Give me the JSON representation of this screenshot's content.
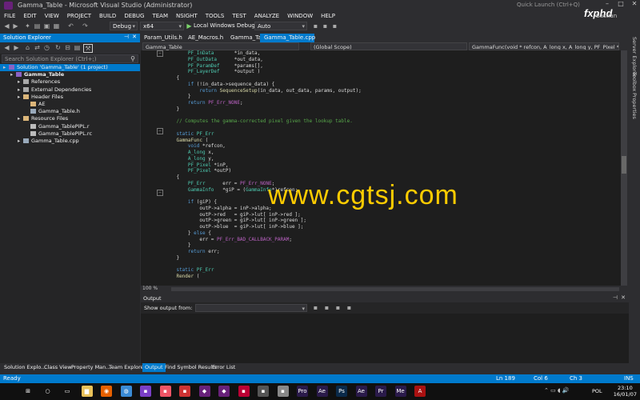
{
  "window": {
    "title": "Gamma_Table - Microsoft Visual Studio (Administrator)",
    "quick_launch": "Quick Launch (Ctrl+Q)",
    "user": "Bastian"
  },
  "watermark": {
    "text": "www.cgtsj.com",
    "logo": "fxphd"
  },
  "menu": [
    "FILE",
    "EDIT",
    "VIEW",
    "PROJECT",
    "BUILD",
    "DEBUG",
    "TEAM",
    "NSIGHT",
    "TOOLS",
    "TEST",
    "ANALYZE",
    "WINDOW",
    "HELP"
  ],
  "toolbar": {
    "config": "Debug",
    "platform": "x64",
    "debugger": "Local Windows Debugger",
    "mode": "Auto"
  },
  "solution_explorer": {
    "title": "Solution Explorer",
    "search_placeholder": "Search Solution Explorer (Ctrl+;)",
    "items": [
      {
        "label": "Solution 'Gamma_Table' (1 project)",
        "indent": 0,
        "selected": true,
        "icon": "solution-icon"
      },
      {
        "label": "Gamma_Table",
        "indent": 1,
        "bold": true,
        "icon": "project-icon"
      },
      {
        "label": "References",
        "indent": 2,
        "icon": "references-icon"
      },
      {
        "label": "External Dependencies",
        "indent": 2,
        "icon": "dependencies-icon"
      },
      {
        "label": "Header Files",
        "indent": 2,
        "icon": "folder-icon"
      },
      {
        "label": "AE",
        "indent": 3,
        "icon": "folder-icon"
      },
      {
        "label": "Gamma_Table.h",
        "indent": 3,
        "icon": "header-file-icon"
      },
      {
        "label": "Resource Files",
        "indent": 2,
        "icon": "folder-icon"
      },
      {
        "label": "Gamma_TablePiPL.r",
        "indent": 3,
        "icon": "resource-file-icon"
      },
      {
        "label": "Gamma_TablePiPL.rc",
        "indent": 3,
        "icon": "resource-file-icon"
      },
      {
        "label": "Gamma_Table.cpp",
        "indent": 2,
        "icon": "cpp-file-icon"
      }
    ]
  },
  "tabs": [
    "Param_Utils.h",
    "AE_Macros.h",
    "Gamma_Table.h",
    "Gamma_Table.cpp"
  ],
  "nav": {
    "project": "Gamma_Table",
    "scope": "(Global Scope)",
    "func": "GammaFunc(void * refcon, A_long x, A_long y, PF_Pixel * inP, PF_Pixel"
  },
  "zoom": "100 %",
  "output": {
    "title": "Output",
    "show_from": "Show output from:"
  },
  "bottom_tabs": [
    "Solution Explo...",
    "Class View",
    "Property Man...",
    "Team Explorer",
    "Output",
    "Find Symbol Results",
    "Error List"
  ],
  "status": {
    "ready": "Ready",
    "ln": "Ln 189",
    "col": "Col 6",
    "ch": "Ch 3",
    "ins": "INS"
  },
  "right_tabs": [
    "Server Explorer",
    "Toolbox",
    "Properties"
  ],
  "clock": {
    "time": "23:10",
    "date": "16/01/07",
    "lang": "POL"
  },
  "taskbar_icons": [
    "windows-start-icon",
    "search-icon",
    "task-view-icon",
    "folder-icon",
    "firefox-icon",
    "chrome-icon",
    "app-icon-1",
    "app-icon-2",
    "app-icon-3",
    "vs-icon",
    "vs-icon-2",
    "app-icon-4",
    "app-icon-5",
    "app-icon-6",
    "premiere-icon",
    "after-effects-icon",
    "photoshop-icon",
    "after-effects-icon-2",
    "premiere-icon-2",
    "media-encoder-icon",
    "acrobat-icon"
  ]
}
